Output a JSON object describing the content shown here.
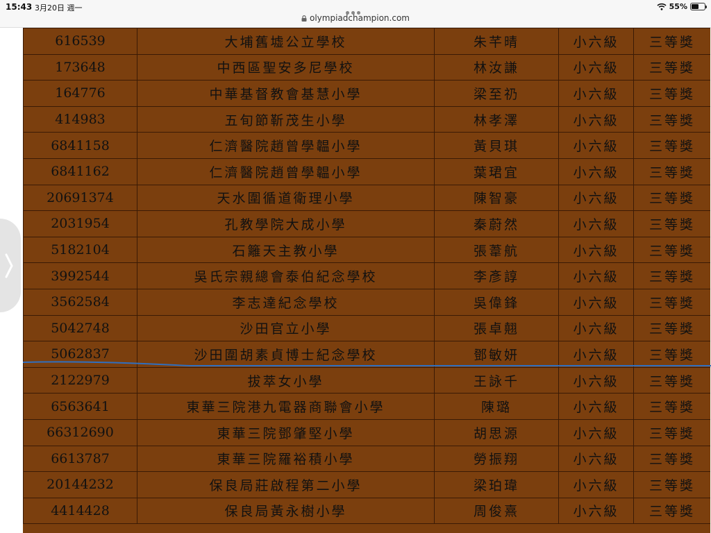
{
  "status_bar": {
    "time": "15:43",
    "date": "3月20日 週一",
    "url": "olympiadchampion.com",
    "battery": "55%",
    "battery_level": 0.55
  },
  "colors": {
    "row_bg": "#7b3f0e",
    "border": "#3a1a05",
    "annotation_line": "#2f6fc0"
  },
  "icons": [
    "lock-icon",
    "wifi-icon",
    "battery-icon",
    "chevron-right-icon"
  ],
  "table": {
    "rows": [
      [
        "616539",
        "大埔舊墟公立學校",
        "朱芊晴",
        "小六級",
        "三等獎"
      ],
      [
        "173648",
        "中西區聖安多尼學校",
        "林汝謙",
        "小六級",
        "三等獎"
      ],
      [
        "164776",
        "中華基督教會基慧小學",
        "梁至礽",
        "小六級",
        "三等獎"
      ],
      [
        "414983",
        "五旬節靳茂生小學",
        "林孝澤",
        "小六級",
        "三等獎"
      ],
      [
        "6841158",
        "仁濟醫院趙曾學韞小學",
        "黃貝琪",
        "小六級",
        "三等獎"
      ],
      [
        "6841162",
        "仁濟醫院趙曾學韞小學",
        "葉珺宜",
        "小六級",
        "三等獎"
      ],
      [
        "20691374",
        "天水圍循道衛理小學",
        "陳智豪",
        "小六級",
        "三等獎"
      ],
      [
        "2031954",
        "孔教學院大成小學",
        "秦蔚然",
        "小六級",
        "三等獎"
      ],
      [
        "5182104",
        "石籬天主教小學",
        "張葦航",
        "小六級",
        "三等獎"
      ],
      [
        "3992544",
        "吳氏宗親總會泰伯紀念學校",
        "李彥諄",
        "小六級",
        "三等獎"
      ],
      [
        "3562584",
        "李志達紀念學校",
        "吳偉鋒",
        "小六級",
        "三等獎"
      ],
      [
        "5042748",
        "沙田官立小學",
        "張卓翹",
        "小六級",
        "三等獎"
      ],
      [
        "5062837",
        "沙田圍胡素貞博士紀念學校",
        "鄧敏妍",
        "小六級",
        "三等獎"
      ],
      [
        "2122979",
        "拔萃女小學",
        "王詠千",
        "小六級",
        "三等獎"
      ],
      [
        "6563641",
        "東華三院港九電器商聯會小學",
        "陳璐",
        "小六級",
        "三等獎"
      ],
      [
        "66312690",
        "東華三院鄧肇堅小學",
        "胡思源",
        "小六級",
        "三等獎"
      ],
      [
        "6613787",
        "東華三院羅裕積小學",
        "勞振翔",
        "小六級",
        "三等獎"
      ],
      [
        "20144232",
        "保良局莊啟程第二小學",
        "梁珀瑋",
        "小六級",
        "三等獎"
      ],
      [
        "4414428",
        "保良局黃永樹小學",
        "周俊熹",
        "小六級",
        "三等獎"
      ]
    ]
  }
}
